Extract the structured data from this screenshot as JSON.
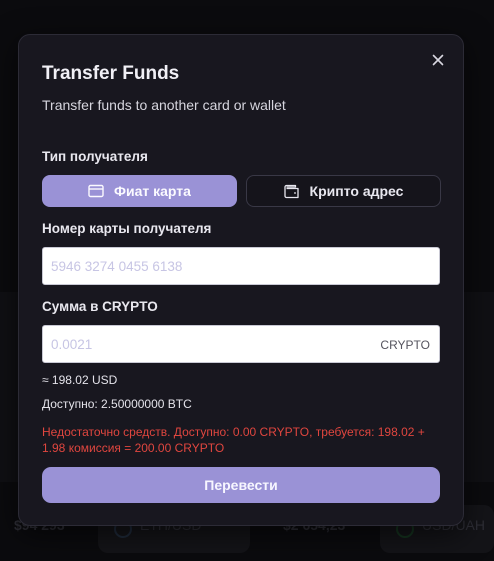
{
  "background": {
    "ticker": [
      {
        "price": "$94 293"
      },
      {
        "pair": "ETH/USD"
      },
      {
        "price": "$2 654,23"
      },
      {
        "pair": "USD/UAH"
      }
    ]
  },
  "modal": {
    "title": "Transfer Funds",
    "subtitle": "Transfer funds to another card or wallet",
    "close_icon": "close-icon",
    "recipient_type_label": "Тип получателя",
    "recipient_types": [
      {
        "label": "Фиат карта",
        "icon": "card-icon",
        "active": true
      },
      {
        "label": "Крипто адрес",
        "icon": "wallet-icon",
        "active": false
      }
    ],
    "card_number_label": "Номер карты получателя",
    "card_number_placeholder": "5946 3274 0455 6138",
    "amount_label": "Сумма в CRYPTO",
    "amount_placeholder": "0.0021",
    "amount_suffix": "CRYPTO",
    "approx_usd": "≈ 198.02 USD",
    "available": "Доступно: 2.50000000 BTC",
    "error": "Недостаточно средств. Доступно: 0.00 CRYPTO, требуется: 198.02 + 1.98 комиссия = 200.00 CRYPTO",
    "submit_label": "Перевести"
  },
  "colors": {
    "accent": "#9a92d6",
    "error": "#e0463f",
    "modal_bg": "#18171f"
  }
}
